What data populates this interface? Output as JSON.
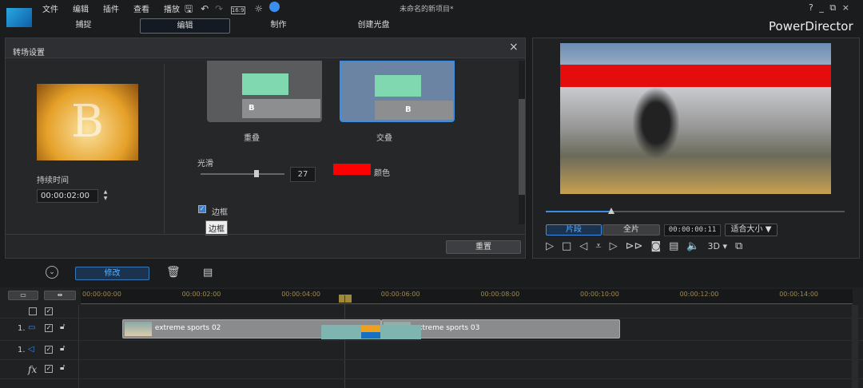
{
  "app": {
    "title": "未命名的新项目*",
    "brand": "PowerDirector",
    "window_controls": [
      "?",
      "_",
      "⧉",
      "×"
    ]
  },
  "menu": [
    "文件",
    "编辑",
    "插件",
    "查看",
    "播放"
  ],
  "toolbar_icons": [
    "save-icon",
    "undo-icon",
    "redo-icon",
    "aspect-ratio-icon",
    "settings-icon",
    "notification-icon"
  ],
  "aspect_label": "16:9",
  "tabs": [
    {
      "label": "捕捉"
    },
    {
      "label": "编辑",
      "active": true
    },
    {
      "label": "制作"
    },
    {
      "label": "创建光盘"
    }
  ],
  "dialog": {
    "title": "转场设置",
    "thumb_letter": "B",
    "duration_label": "持续时间",
    "duration": "00:00:02:00",
    "modes": [
      {
        "label": "重叠"
      },
      {
        "label": "交叠",
        "selected": true
      }
    ],
    "smooth_label": "光滑",
    "smooth_value": "27",
    "color_label": "颜色",
    "border_color": "#ff0000",
    "border_label": "边框",
    "border_checked": true,
    "tooltip": "边框",
    "reset_label": "重置"
  },
  "preview": {
    "seg_label": "片段",
    "full_label": "全片",
    "timecode": "00:00:00:11",
    "fit_label": "适合大小",
    "mode_3d": "3D",
    "progress": 0.22
  },
  "edit_toolbar": {
    "modify_label": "修改"
  },
  "timeline": {
    "ticks": [
      "00:00:00:00",
      "00:00:02:00",
      "00:00:04:00",
      "00:00:06:00",
      "00:00:08:00",
      "00:00:10:00",
      "00:00:12:00",
      "00:00:14:00"
    ],
    "playhead": "00:00:04:11",
    "tracks": [
      {
        "label": "1."
      },
      {
        "label": "1."
      },
      {
        "label": "fx"
      }
    ],
    "clips": [
      {
        "name": "extreme sports 02",
        "start": 0.8,
        "end": 6.0
      },
      {
        "name": "extreme sports 03",
        "start": 6.0,
        "end": 10.8
      }
    ],
    "transition": {
      "start": 4.8,
      "end": 6.8
    }
  }
}
